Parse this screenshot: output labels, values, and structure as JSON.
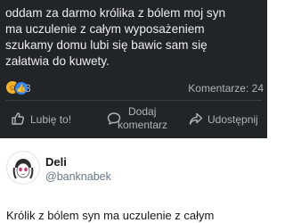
{
  "facebook_post": {
    "text_lines": [
      "oddam za darmo królika z bólem moj syn",
      "ma uczulenie z całym wyposażeniem",
      "szukamy domu lubi się bawic sam się",
      "załatwia do kuwety."
    ],
    "reaction_count": "3",
    "comments_count": "Komentarze: 24",
    "actions": {
      "like": "Lubię to!",
      "comment_line1": "Dodaj",
      "comment_line2": "komentarz",
      "share": "Udostępnij"
    }
  },
  "tweet": {
    "author_name": "Deli",
    "author_handle": "@banknabek",
    "text": "Królik z bólem syn ma uczulenie z całym"
  },
  "colors": {
    "post_bg": "#222528",
    "post_text": "#eceef0",
    "muted": "#b0b3b8",
    "like_blue": "#2d86ff",
    "haha_yellow": "#f7b125"
  },
  "icons": [
    "haha-reaction-icon",
    "like-reaction-icon",
    "thumbs-up-icon",
    "comment-bubble-icon",
    "share-arrow-icon",
    "avatar-drawing-icon"
  ]
}
